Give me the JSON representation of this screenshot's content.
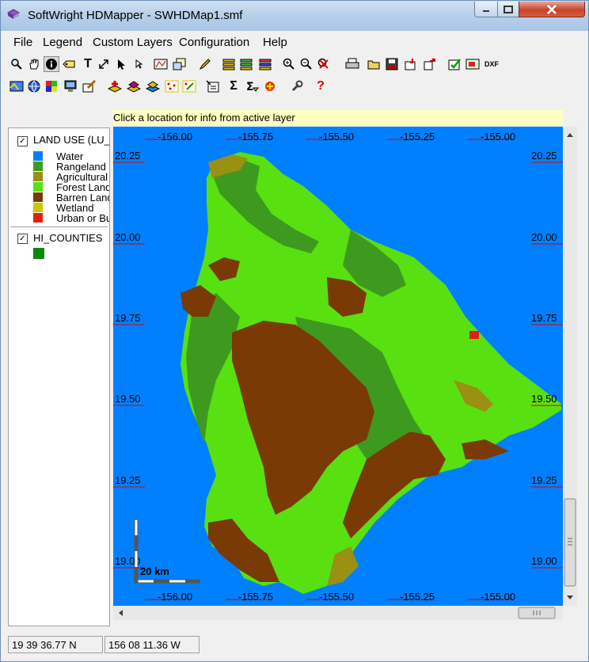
{
  "window": {
    "title": "SoftWright HDMapper - SWHDMap1.smf"
  },
  "menu": [
    "File",
    "Legend",
    "Custom Layers",
    "Configuration",
    "Help"
  ],
  "infobar": {
    "text": "Click a location for info from active layer"
  },
  "legend": {
    "layers": [
      {
        "title": "LAND USE (LU_",
        "checked": true,
        "items": [
          {
            "label": "Water",
            "color": "#0080ff"
          },
          {
            "label": "Rangeland",
            "color": "#3e9a1e"
          },
          {
            "label": "Agricultural",
            "color": "#9a9012"
          },
          {
            "label": "Forest Land",
            "color": "#58e010"
          },
          {
            "label": "Barren Land",
            "color": "#7a3a05"
          },
          {
            "label": "Wetland",
            "color": "#c8c800"
          },
          {
            "label": "Urban or Bu",
            "color": "#e02010"
          }
        ]
      },
      {
        "title": "HI_COUNTIES",
        "checked": true,
        "items": [
          {
            "label": "",
            "color": "#0a8a0a"
          }
        ]
      }
    ]
  },
  "map": {
    "lon_labels_top": [
      "-156.00",
      "-155.75",
      "-155.50",
      "-155.25",
      "-155.00"
    ],
    "lon_labels_bottom": [
      "-156.00",
      "-155.75",
      "-155.50",
      "-155.25",
      "-155.00"
    ],
    "lat_labels": [
      "20.25",
      "20.00",
      "19.75",
      "19.50",
      "19.25",
      "19.00"
    ],
    "scale_label": "20 km"
  },
  "status": {
    "lat": "19 39 36.77 N",
    "lon": "156 08 11.36 W"
  },
  "toolbar1_icons": [
    "zoom-icon",
    "pan-hand-icon",
    "info-icon",
    "label-icon",
    "text-icon",
    "resize-icon",
    "pointer-icon",
    "select-icon",
    "polygon-icon",
    "window-icon",
    "pencil-icon",
    "layers-add-icon",
    "layers-remove-icon",
    "layers-edit-icon",
    "zoom-in-icon",
    "zoom-out-icon",
    "zoom-cancel-icon",
    "print-icon",
    "open-icon",
    "save-icon",
    "import-icon",
    "export-icon",
    "check-icon",
    "convert-icon",
    "dxf-icon"
  ],
  "toolbar2_icons": [
    "color-icon",
    "globe-icon",
    "grid-icon",
    "monitor-icon",
    "brush-icon",
    "add-layer-icon",
    "layer-up-icon",
    "layer-down-icon",
    "points-icon",
    "points-edit-icon",
    "properties-icon",
    "sum-icon",
    "sum-edit-icon",
    "special-icon",
    "wrench-icon",
    "help-icon"
  ],
  "toolbar_text": {
    "dxf": "DXF",
    "sum": "Σ",
    "help": "?",
    "text": "T",
    "info": "i"
  }
}
